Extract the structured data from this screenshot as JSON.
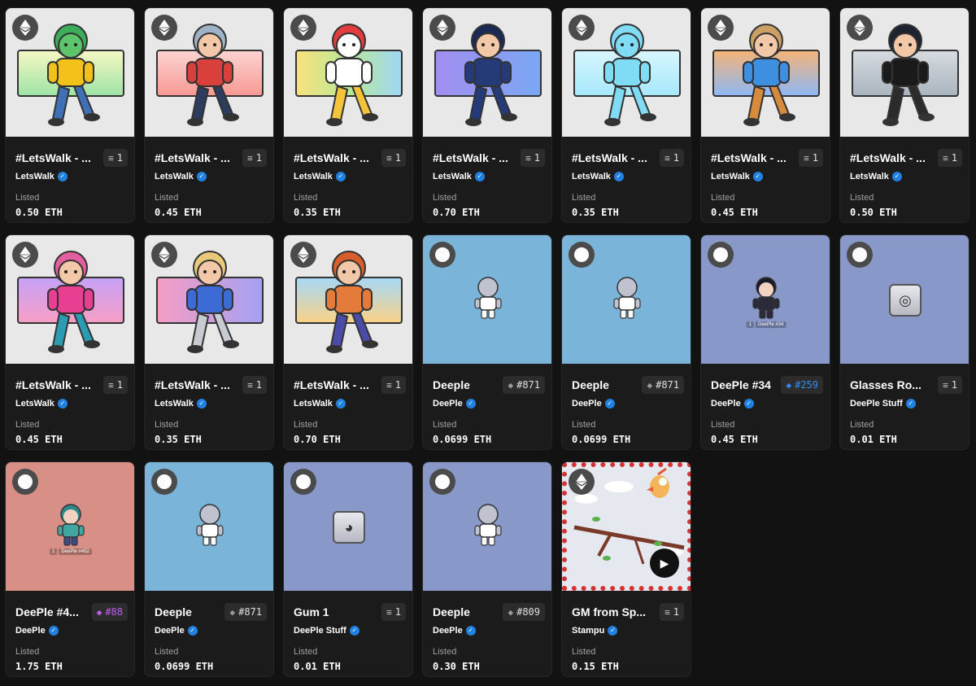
{
  "listed_label": "Listed",
  "cards": [
    {
      "name": "#LetsWalk - ...",
      "creator": "LetsWalk",
      "badge": "1",
      "badge_kind": "stack",
      "price": "0.50 ETH",
      "chain": "eth",
      "bg": "#e8e8e8",
      "banner": "linear-gradient(180deg,#f6f8c4,#9fe4a6)",
      "char": "frog",
      "shirt": "#f2c21b",
      "pants": "#3f6fb5",
      "hair": "#3cae5a"
    },
    {
      "name": "#LetsWalk - ...",
      "creator": "LetsWalk",
      "badge": "1",
      "badge_kind": "stack",
      "price": "0.45 ETH",
      "chain": "eth",
      "bg": "#e8e8e8",
      "banner": "linear-gradient(180deg,#fdd3d0,#f79a94)",
      "char": "singer",
      "shirt": "#d9403b",
      "pants": "#2c3c5c",
      "hair": "#9fb3c6"
    },
    {
      "name": "#LetsWalk - ...",
      "creator": "LetsWalk",
      "badge": "1",
      "badge_kind": "stack",
      "price": "0.35 ETH",
      "chain": "eth",
      "bg": "#e8e8e8",
      "banner": "linear-gradient(90deg,#f8e27c,#b9e89a,#9fd8f3)",
      "char": "chicken",
      "shirt": "#ffffff",
      "pants": "#f3c43a",
      "hair": "#e23c3c"
    },
    {
      "name": "#LetsWalk - ...",
      "creator": "LetsWalk",
      "badge": "1",
      "badge_kind": "stack",
      "price": "0.70 ETH",
      "chain": "eth",
      "bg": "#e8e8e8",
      "banner": "linear-gradient(90deg,#a28ef0,#7aa7f4)",
      "char": "jiangshi",
      "shirt": "#243a79",
      "pants": "#243a79",
      "hair": "#1b2a55"
    },
    {
      "name": "#LetsWalk - ...",
      "creator": "LetsWalk",
      "badge": "1",
      "badge_kind": "stack",
      "price": "0.35 ETH",
      "chain": "eth",
      "bg": "#e8e8e8",
      "banner": "linear-gradient(180deg,#d6f6ff,#a7e8fb)",
      "char": "water",
      "shirt": "#7fdcf4",
      "pants": "#7fdcf4",
      "hair": "#7fdcf4"
    },
    {
      "name": "#LetsWalk - ...",
      "creator": "LetsWalk",
      "badge": "1",
      "badge_kind": "stack",
      "price": "0.45 ETH",
      "chain": "eth",
      "bg": "#e8e8e8",
      "banner": "linear-gradient(180deg,#f4b37a,#8fb8f4)",
      "char": "aviator",
      "shirt": "#3f8fe0",
      "pants": "#d68a3b",
      "hair": "#caa064"
    },
    {
      "name": "#LetsWalk - ...",
      "creator": "LetsWalk",
      "badge": "1",
      "badge_kind": "stack",
      "price": "0.50 ETH",
      "chain": "eth",
      "bg": "#e8e8e8",
      "banner": "linear-gradient(180deg,#d6dbe0,#aab5bf)",
      "char": "dark",
      "shirt": "#1a1a1a",
      "pants": "#2b2b2b",
      "hair": "#1d2430"
    },
    {
      "name": "#LetsWalk - ...",
      "creator": "LetsWalk",
      "badge": "1",
      "badge_kind": "stack",
      "price": "0.45 ETH",
      "chain": "eth",
      "bg": "#e8e8e8",
      "banner": "linear-gradient(180deg,#c6a2f7,#f79ec6)",
      "char": "pink",
      "shirt": "#e83f93",
      "pants": "#2c9cb3",
      "hair": "#e45fa0"
    },
    {
      "name": "#LetsWalk - ...",
      "creator": "LetsWalk",
      "badge": "1",
      "badge_kind": "stack",
      "price": "0.35 ETH",
      "chain": "eth",
      "bg": "#e8e8e8",
      "banner": "linear-gradient(90deg,#f59ec4,#a5a0f3)",
      "char": "farmer",
      "shirt": "#3d6bd6",
      "pants": "#c8ccd2",
      "hair": "#e8c97a"
    },
    {
      "name": "#LetsWalk - ...",
      "creator": "LetsWalk",
      "badge": "1",
      "badge_kind": "stack",
      "price": "0.70 ETH",
      "chain": "eth",
      "bg": "#e8e8e8",
      "banner": "linear-gradient(180deg,#a8d8f4,#f9d28a)",
      "char": "wheelchair",
      "shirt": "#e47b3a",
      "pants": "#4b4ba8",
      "hair": "#d85c2c"
    },
    {
      "name": "Deeple",
      "creator": "DeePle",
      "badge": "#871",
      "badge_kind": "diamond-gray",
      "price": "0.0699 ETH",
      "chain": "circle",
      "bg": "#7ab4d8",
      "char": "deeple",
      "shirt": "#ffffff",
      "pants": "#ffffff",
      "hair": "#b4b6c8"
    },
    {
      "name": "Deeple",
      "creator": "DeePle",
      "badge": "#871",
      "badge_kind": "diamond-gray",
      "price": "0.0699 ETH",
      "chain": "circle",
      "bg": "#7ab4d8",
      "char": "deeple",
      "shirt": "#ffffff",
      "pants": "#ffffff",
      "hair": "#b4b6c8"
    },
    {
      "name": "DeePle #34",
      "creator": "DeePle",
      "badge": "#259",
      "badge_kind": "diamond-blue",
      "price": "0.45 ETH",
      "chain": "circle",
      "bg": "#8898c8",
      "char": "deeple34",
      "shirt": "#2a2a3a",
      "pants": "#2a2a3a",
      "hair": "#1a1a2a",
      "plate_num": "1",
      "plate_name": "DeePle #34"
    },
    {
      "name": "Glasses Ro...",
      "creator": "DeePle Stuff",
      "badge": "1",
      "badge_kind": "stack",
      "price": "0.01 ETH",
      "chain": "circle",
      "bg": "#8898c8",
      "char": "glasses",
      "glyph": "◎"
    },
    {
      "name": "DeePle #4...",
      "creator": "DeePle",
      "badge": "#88",
      "badge_kind": "diamond-purple",
      "price": "1.75 ETH",
      "chain": "circle",
      "bg": "#d88f86",
      "char": "deeple452",
      "shirt": "#3fa6a0",
      "pants": "#3b4b8c",
      "hair": "#2d8a8a",
      "plate_num": "1",
      "plate_name": "DeePle #452"
    },
    {
      "name": "Deeple",
      "creator": "DeePle",
      "badge": "#871",
      "badge_kind": "diamond-gray",
      "price": "0.0699 ETH",
      "chain": "circle",
      "bg": "#7ab4d8",
      "char": "deeple",
      "shirt": "#ffffff",
      "pants": "#ffffff",
      "hair": "#b4b6c8"
    },
    {
      "name": "Gum 1",
      "creator": "DeePle Stuff",
      "badge": "1",
      "badge_kind": "stack",
      "price": "0.01 ETH",
      "chain": "circle",
      "bg": "#8898c8",
      "char": "gum",
      "glyph": "◕"
    },
    {
      "name": "Deeple",
      "creator": "DeePle",
      "badge": "#809",
      "badge_kind": "diamond-gray",
      "price": "0.30 ETH",
      "chain": "circle",
      "bg": "#8898c8",
      "char": "deeple",
      "shirt": "#ffffff",
      "pants": "#ffffff",
      "hair": "#b4b6c8"
    },
    {
      "name": "GM from Sp...",
      "creator": "Stampu",
      "badge": "1",
      "badge_kind": "stack",
      "price": "0.15 ETH",
      "chain": "eth",
      "bg": "#e5e8ee",
      "char": "stamp",
      "video": true
    }
  ],
  "icons": {
    "chain_eth": "ethereum-icon",
    "chain_circle": "circle-icon",
    "verified": "verified-icon",
    "stack": "stack-icon",
    "diamond": "diamond-icon",
    "play": "play-icon"
  },
  "colors": {
    "page_bg": "#121212",
    "card_bg": "#1b1b1b",
    "verified": "#2081e2",
    "diamond_blue": "#2b8ff7",
    "diamond_purple": "#c35cf0",
    "badge_bg": "#2c2c2c",
    "stamp_border": "#d63232"
  }
}
